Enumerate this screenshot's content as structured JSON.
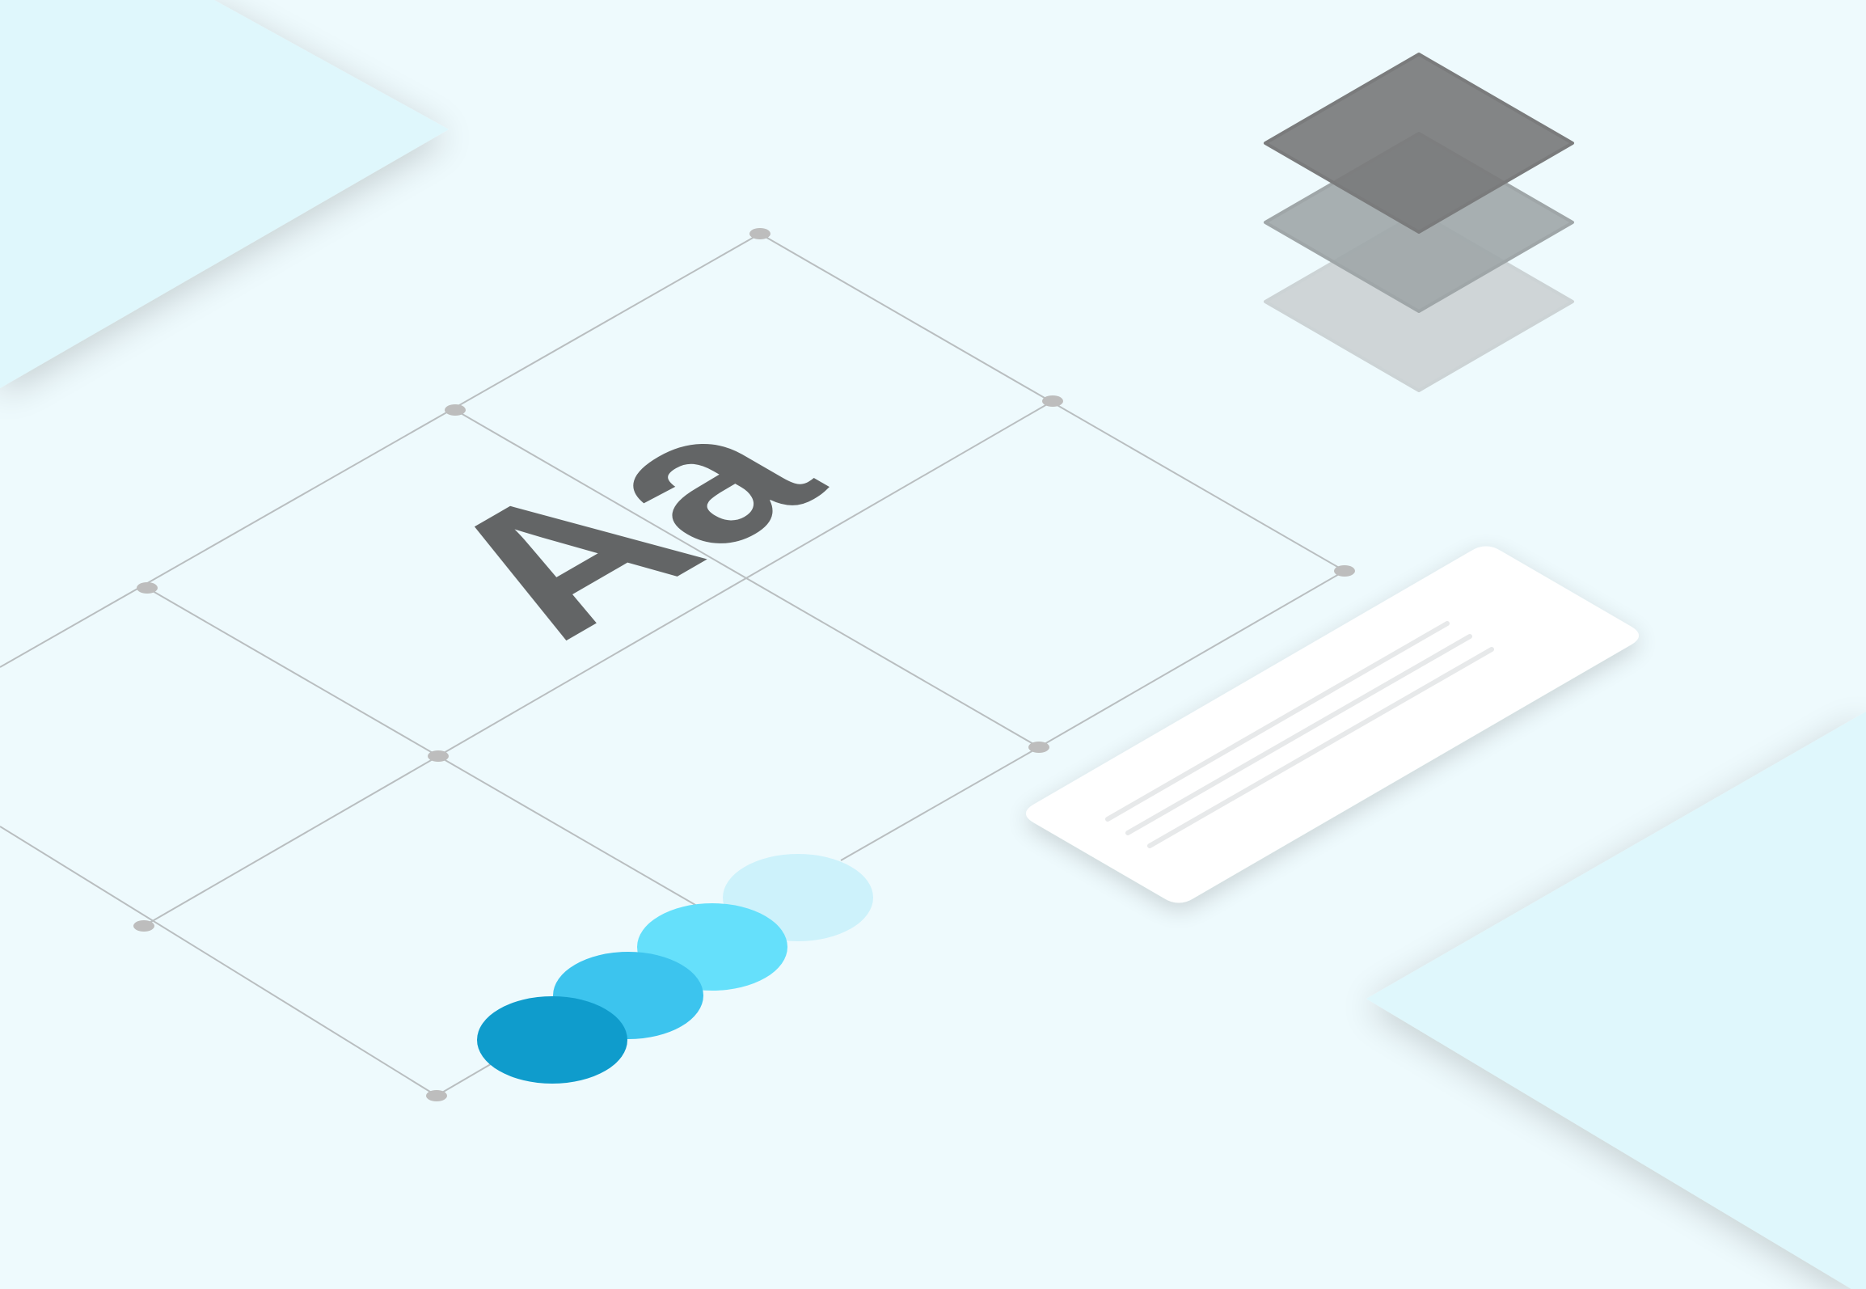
{
  "illustration": {
    "theme": "design-system",
    "glyph_text": "Aa",
    "colors": {
      "background": "#EEFAFD",
      "corner_panel": "#DFF7FC",
      "grid_line": "#B9BEC0",
      "grid_node": "#BDBDBD",
      "glyph": "#5E6061",
      "card": "#FFFFFF",
      "card_line": "#E7E9EA",
      "layer_top": "#7A7B7C",
      "layer_middle": "#9FA6A8",
      "layer_bottom": "#CCD3D5"
    },
    "palette_swatches": [
      "#0F9CCC",
      "#3CC4EE",
      "#65E0FB",
      "#CDF2FB"
    ],
    "layer_stack_count": 3,
    "card_line_count": 3,
    "icons": [
      "grid-node-icon",
      "layers-icon"
    ]
  }
}
